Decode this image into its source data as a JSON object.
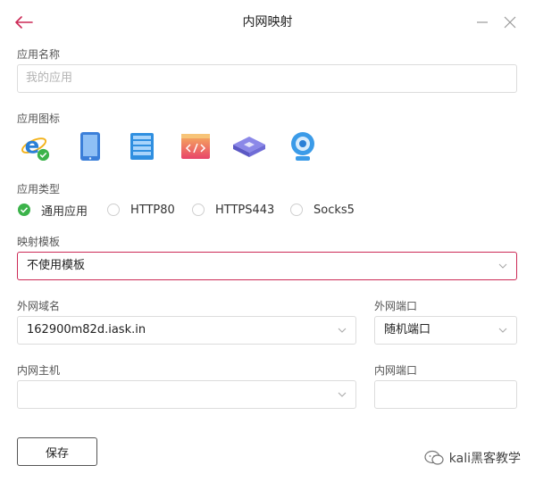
{
  "header": {
    "title": "内网映射"
  },
  "form": {
    "app_name_label": "应用名称",
    "app_name_placeholder": "我的应用",
    "app_icon_label": "应用图标",
    "icons": [
      "ie-icon",
      "tablet-icon",
      "server-icon",
      "code-window-icon",
      "router-icon",
      "webcam-icon"
    ],
    "selected_icon": "ie-icon",
    "app_type_label": "应用类型",
    "app_types": [
      "通用应用",
      "HTTP80",
      "HTTPS443",
      "Socks5"
    ],
    "selected_type": "通用应用",
    "template_label": "映射模板",
    "template_value": "不使用模板",
    "external_domain_label": "外网域名",
    "external_domain_value": "162900m82d.iask.in",
    "external_port_label": "外网端口",
    "external_port_value": "随机端口",
    "internal_host_label": "内网主机",
    "internal_host_value": "",
    "internal_port_label": "内网端口",
    "internal_port_value": "",
    "save_label": "保存"
  },
  "watermark": {
    "text": "kali黑客教学"
  },
  "colors": {
    "accent": "#cc2a56",
    "success": "#3bb34a",
    "border": "#dcdcdc"
  }
}
